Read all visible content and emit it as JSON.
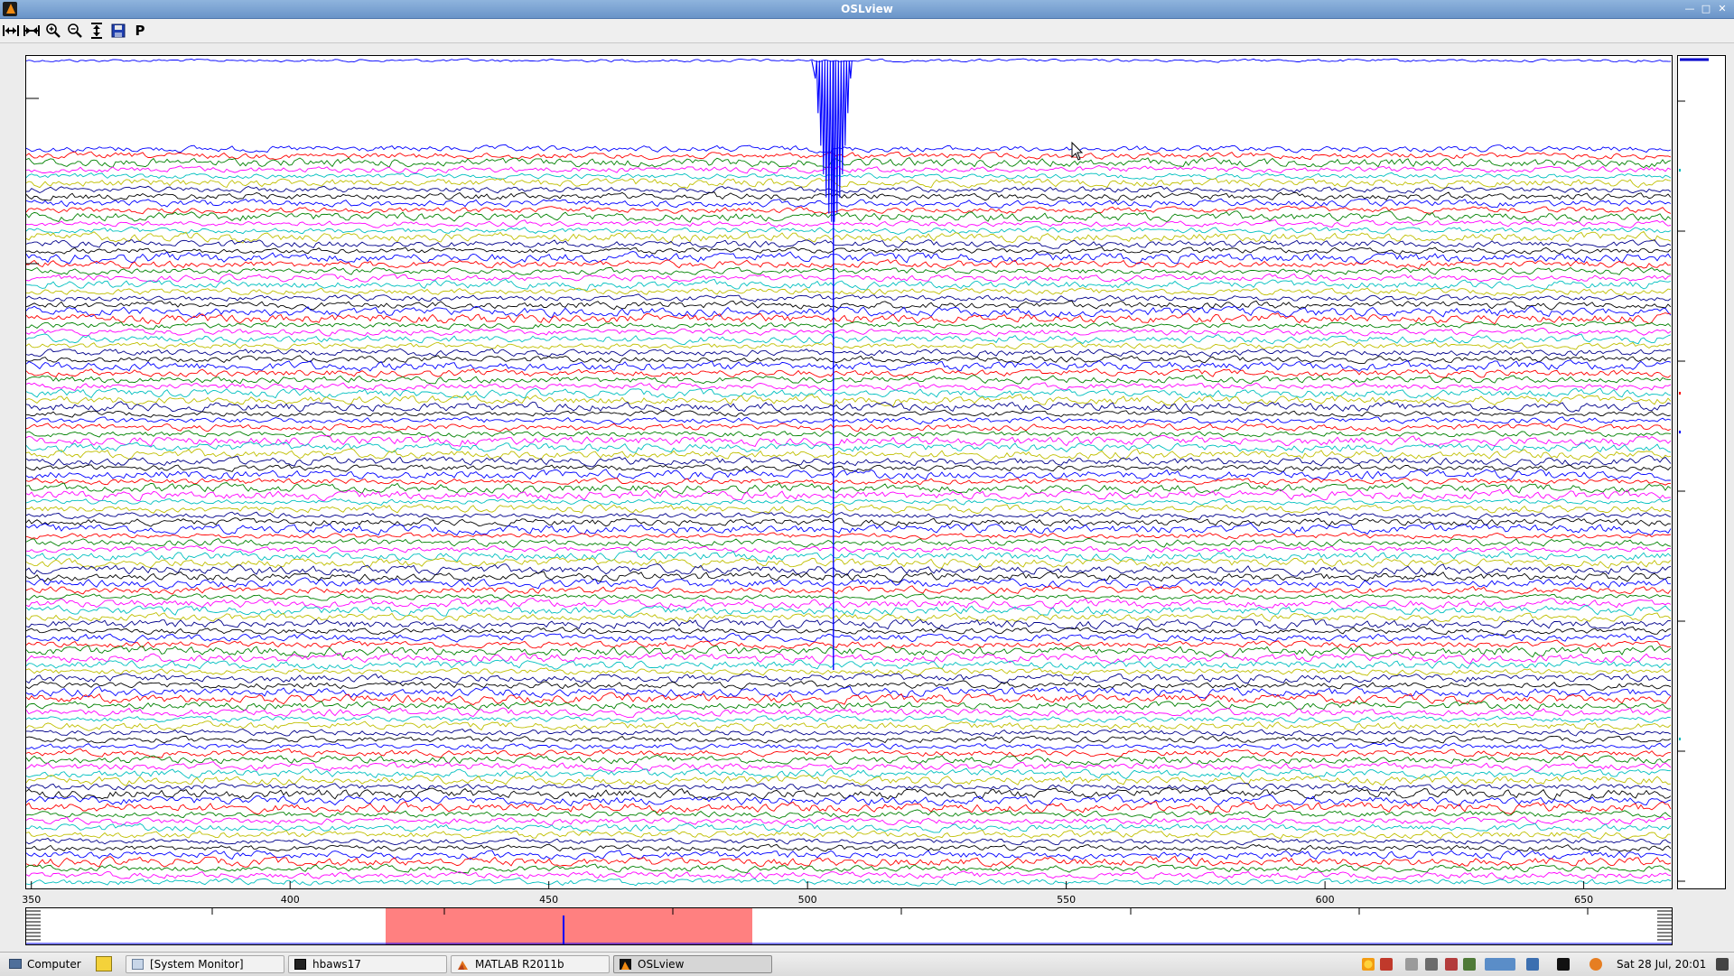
{
  "window": {
    "title": "OSLview",
    "controls": [
      "minimize-icon",
      "maximize-icon",
      "close-icon"
    ]
  },
  "toolbar": {
    "buttons": [
      {
        "name": "expand-horizontal-icon"
      },
      {
        "name": "contract-horizontal-icon"
      },
      {
        "name": "zoom-in-icon"
      },
      {
        "name": "zoom-out-icon"
      },
      {
        "name": "vertical-scale-icon"
      },
      {
        "name": "save-icon"
      },
      {
        "name": "p-button",
        "label": "P"
      }
    ]
  },
  "chart_data": {
    "type": "line",
    "title": "",
    "xlabel": "",
    "ylabel": "",
    "x_ticks": [
      "350",
      "400",
      "450",
      "500",
      "550",
      "600",
      "650"
    ],
    "xlim": [
      349,
      667
    ],
    "channel_count": 110,
    "channel_colors": [
      "#000000",
      "#0000ff",
      "#ff0000",
      "#008000",
      "#ff00ff",
      "#00bfbf",
      "#bfbf00",
      "#00008b"
    ],
    "artifact": {
      "x": 505,
      "color": "#0000ff"
    },
    "grid": false,
    "legend": "none",
    "overview": {
      "highlight_range": [
        420,
        490
      ],
      "highlight_color": "#ff8080",
      "spike_x": 452
    }
  },
  "taskbar": {
    "menu_label": "Computer",
    "tasks": [
      {
        "label": "[System Monitor]",
        "icon": "monitor-icon"
      },
      {
        "label": "hbaws17",
        "icon": "terminal-icon"
      },
      {
        "label": "MATLAB  R2011b",
        "icon": "matlab-icon"
      },
      {
        "label": "OSLview",
        "icon": "matlab-figure-icon",
        "active": true
      }
    ],
    "clock": "Sat 28 Jul, 20:01"
  }
}
